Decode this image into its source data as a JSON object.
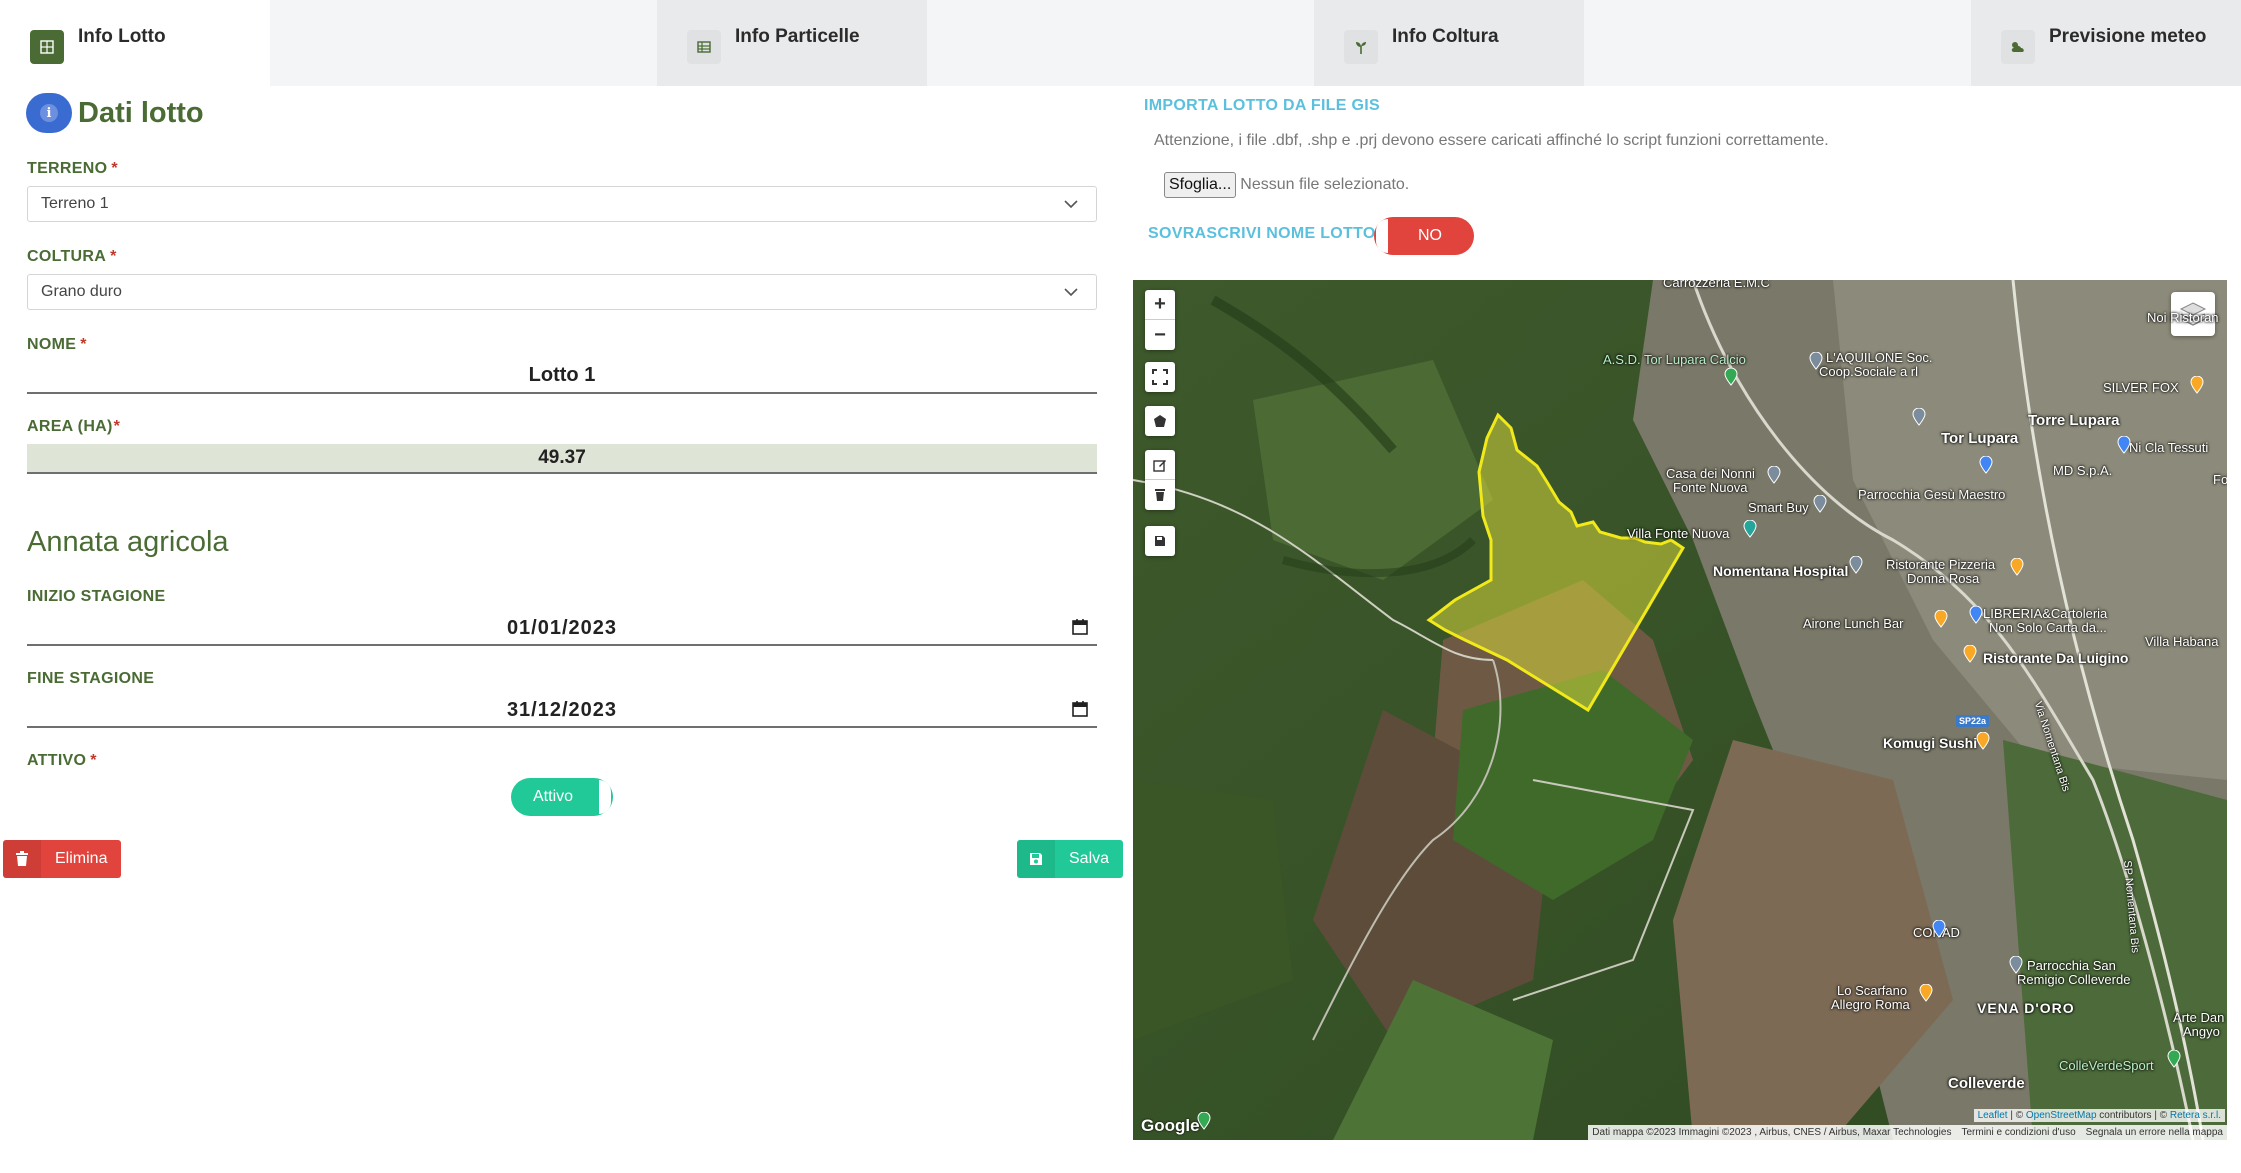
{
  "tabs": [
    {
      "label": "Info Lotto",
      "icon": "grid-icon",
      "active": true
    },
    {
      "label": "Info Particelle",
      "icon": "table-icon",
      "active": false
    },
    {
      "label": "Info Coltura",
      "icon": "sprout-icon",
      "active": false
    },
    {
      "label": "Previsione meteo",
      "icon": "cloud-sun-icon",
      "active": false
    }
  ],
  "dati_lotto": {
    "title": "Dati lotto",
    "terreno_label": "TERRENO",
    "terreno_value": "Terreno 1",
    "coltura_label": "COLTURA",
    "coltura_value": "Grano duro",
    "nome_label": "NOME",
    "nome_value": "Lotto 1",
    "area_label": "AREA (HA)",
    "area_value": "49.37",
    "required_mark": "*"
  },
  "annata": {
    "title": "Annata agricola",
    "inizio_label": "INIZIO STAGIONE",
    "inizio_value": "01/01/2023",
    "fine_label": "FINE STAGIONE",
    "fine_value": "31/12/2023",
    "attivo_label": "ATTIVO",
    "attivo_toggle": "Attivo"
  },
  "actions": {
    "delete_label": "Elimina",
    "save_label": "Salva"
  },
  "gis": {
    "title": "IMPORTA LOTTO DA FILE GIS",
    "note": "Attenzione, i file .dbf, .shp e .prj devono essere caricati affinché lo script funzioni correttamente.",
    "browse_label": "Sfoglia...",
    "no_file": "Nessun file selezionato.",
    "overwrite_label": "SOVRASCRIVI NOME LOTTO",
    "overwrite_toggle": "NO"
  },
  "map": {
    "zoom_in": "+",
    "zoom_out": "−",
    "labels": [
      "Carrozzeria E.M.C",
      "A.S.D. Tor Lupara Calcio",
      "L'AQUILONE Soc.",
      "Coop.Sociale a rl",
      "Noi Ristoran",
      "SILVER FOX",
      "Tor Lupara",
      "Torre Lupara",
      "Ni Cla Tessuti",
      "MD S.p.A.",
      "Casa dei Nonni",
      "Fonte Nuova",
      "Parrocchia Gesù Maestro",
      "Smart Buy",
      "Villa Fonte Nuova",
      "Nomentana Hospital",
      "Ristorante Pizzeria",
      "Donna Rosa",
      "LIBRERIA&Cartoleria",
      "Non Solo Carta da...",
      "Airone Lunch Bar",
      "Villa Habana",
      "Ristorante Da Luigino",
      "SP22a",
      "Komugi Sushi",
      "Via Nomentana Bis",
      "SP Nomentana Bis",
      "CONAD",
      "Parrocchia San",
      "Remigio Colleverde",
      "Lo Scarfano",
      "Allegro Roma",
      "VENA D'ORO",
      "Arte Dan",
      "Angyo",
      "ColleVerdeSport",
      "Colleverde",
      "Fo"
    ],
    "google": "Google",
    "attribution": {
      "leaflet": "Leaflet",
      "sep1": "| ©",
      "osm": "OpenStreetMap",
      "contrib": "contributors | ©",
      "retera": "Retera s.r.l."
    },
    "footer": [
      "Dati mappa ©2023 Immagini ©2023 , Airbus, CNES / Airbus, Maxar Technologies",
      "Termini e condizioni d'uso",
      "Segnala un errore nella mappa"
    ],
    "colors": {
      "polygon_fill": "#d4d63a",
      "polygon_stroke": "#f2e91a"
    }
  },
  "colors": {
    "brand_green": "#4a6b34",
    "accent_blue": "#5bc0de",
    "success": "#20c997",
    "danger": "#e0443c"
  }
}
